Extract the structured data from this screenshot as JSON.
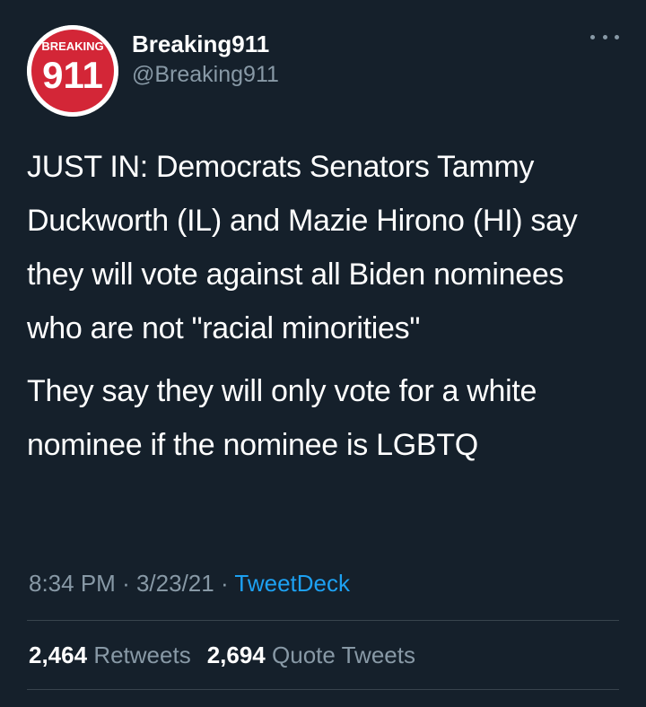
{
  "author": {
    "display_name": "Breaking911",
    "handle": "@Breaking911",
    "avatar_icon": "breaking911-logo-icon",
    "avatar_text_top": "BREAKING",
    "avatar_text_main": "911"
  },
  "tweet": {
    "paragraphs": [
      "JUST IN: Democrats Senators Tammy Duckworth (IL) and Mazie Hirono (HI) say they will vote against all Biden nominees who are not \"racial minorities\"",
      "They say they will only vote for a white nominee if the nominee is LGBTQ"
    ],
    "time": "8:34 PM",
    "date": "3/23/21",
    "separator": "·",
    "source": "TweetDeck"
  },
  "stats": {
    "retweets_count": "2,464",
    "retweets_label": "Retweets",
    "quotes_count": "2,694",
    "quotes_label": "Quote Tweets"
  },
  "colors": {
    "background": "#15202b",
    "primary_text": "#ffffff",
    "secondary_text": "#8899a6",
    "accent": "#1da1f2",
    "divider": "#38444d",
    "logo_red": "#d32637"
  }
}
